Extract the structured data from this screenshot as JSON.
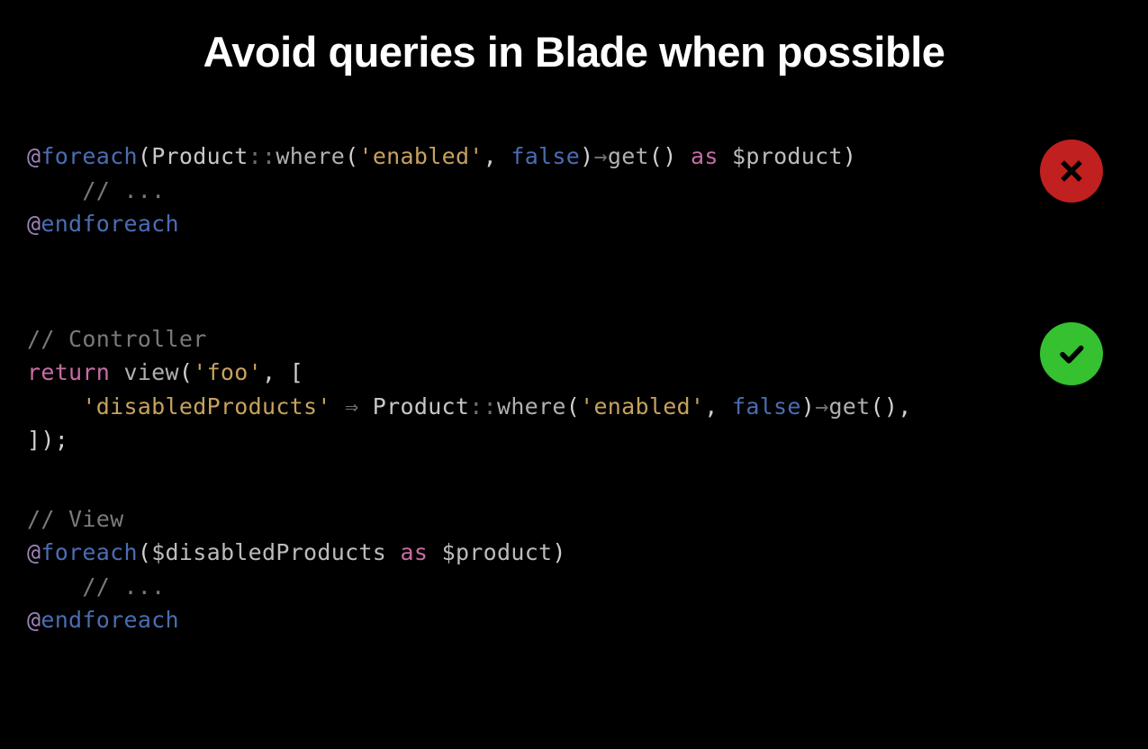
{
  "title": "Avoid queries in Blade when possible",
  "block1": {
    "badge": "cross",
    "code": {
      "l1_at": "@",
      "l1_foreach": "foreach",
      "l1_open": "(",
      "l1_class": "Product",
      "l1_scope": "::",
      "l1_where": "where",
      "l1_p1": "(",
      "l1_str1": "'enabled'",
      "l1_comma": ", ",
      "l1_false": "false",
      "l1_p2": ")",
      "l1_arrow": "→",
      "l1_get": "get",
      "l1_p3": "() ",
      "l1_as": "as",
      "l1_space": " ",
      "l1_var": "$product",
      "l1_close": ")",
      "l2_indent": "    ",
      "l2_comment": "// ...",
      "l3_at": "@",
      "l3_end": "endforeach"
    }
  },
  "block2": {
    "badge": "check",
    "code": {
      "l1_comment": "// Controller",
      "l2_return": "return",
      "l2_space1": " ",
      "l2_view": "view",
      "l2_p1": "(",
      "l2_str1": "'foo'",
      "l2_comma": ", [",
      "l3_indent": "    ",
      "l3_key": "'disabledProducts'",
      "l3_fat": " ⇒ ",
      "l3_class": "Product",
      "l3_scope": "::",
      "l3_where": "where",
      "l3_p1": "(",
      "l3_str2": "'enabled'",
      "l3_comma2": ", ",
      "l3_false": "false",
      "l3_p2": ")",
      "l3_arrow": "→",
      "l3_get": "get",
      "l3_p3": "(),",
      "l4_close": "]);"
    }
  },
  "block3": {
    "code": {
      "l1_comment": "// View",
      "l2_at": "@",
      "l2_foreach": "foreach",
      "l2_open": "(",
      "l2_var1": "$disabledProducts",
      "l2_space1": " ",
      "l2_as": "as",
      "l2_space2": " ",
      "l2_var2": "$product",
      "l2_close": ")",
      "l3_indent": "    ",
      "l3_comment": "// ...",
      "l4_at": "@",
      "l4_end": "endforeach"
    }
  }
}
